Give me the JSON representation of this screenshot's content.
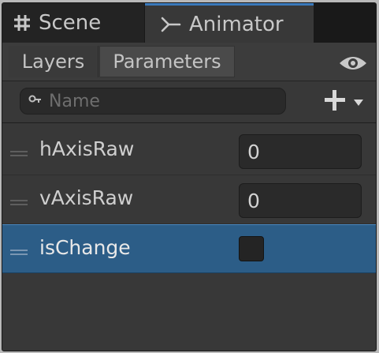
{
  "tabs": [
    {
      "label": "Scene",
      "icon": "grid-icon"
    },
    {
      "label": "Animator",
      "icon": "animator-icon"
    }
  ],
  "subtabs": [
    {
      "label": "Layers"
    },
    {
      "label": "Parameters"
    }
  ],
  "search": {
    "placeholder": "Name",
    "value": ""
  },
  "parameters": [
    {
      "name": "hAxisRaw",
      "value": "0"
    },
    {
      "name": "vAxisRaw",
      "value": "0"
    },
    {
      "name": "isChange",
      "checked": false
    }
  ],
  "colors": {
    "accent": "#3a79bb",
    "selection": "#2c5d87",
    "panel": "#383838"
  }
}
